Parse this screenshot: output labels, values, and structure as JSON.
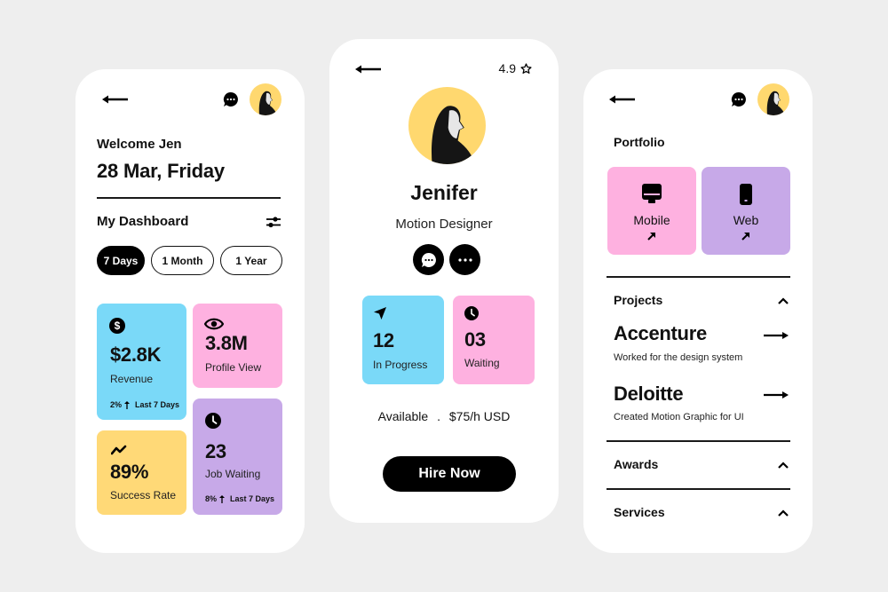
{
  "dashboard": {
    "welcome": "Welcome Jen",
    "date": "28 Mar, Friday",
    "section_title": "My Dashboard",
    "filters": [
      {
        "label": "7 Days",
        "active": true
      },
      {
        "label": "1 Month",
        "active": false
      },
      {
        "label": "1 Year",
        "active": false
      }
    ],
    "tiles": {
      "revenue": {
        "icon": "dollar-icon",
        "value": "$2.8K",
        "label": "Revenue",
        "footer_value": "2%",
        "footer_text": "Last 7 Days",
        "color": "#7ad9f8"
      },
      "profile_view": {
        "icon": "eye-icon",
        "value": "3.8M",
        "label": "Profile View",
        "color": "#feb1e0"
      },
      "success_rate": {
        "icon": "trend-icon",
        "value": "89%",
        "label": "Success Rate",
        "color": "#ffd977"
      },
      "job_waiting": {
        "icon": "clock-icon",
        "value": "23",
        "label": "Job Waiting",
        "footer_value": "8%",
        "footer_text": "Last 7 Days",
        "color": "#c7a9e8"
      }
    }
  },
  "profile": {
    "rating": "4.9",
    "name": "Jenifer",
    "role": "Motion Designer",
    "stats": {
      "in_progress": {
        "value": "12",
        "label": "In Progress",
        "color": "#7ad9f8"
      },
      "waiting": {
        "value": "03",
        "label": "Waiting",
        "color": "#feb1e0"
      }
    },
    "availability": "Available",
    "separator": ".",
    "rate": "$75/h USD",
    "hire_label": "Hire Now"
  },
  "portfolio": {
    "title": "Portfolio",
    "categories": [
      {
        "label": "Mobile",
        "color": "#feb1e0"
      },
      {
        "label": "Web",
        "color": "#c7a9e8"
      }
    ],
    "projects_title": "Projects",
    "projects": [
      {
        "name": "Accenture",
        "description": "Worked for the design system"
      },
      {
        "name": "Deloitte",
        "description": "Created Motion Graphic for UI"
      }
    ],
    "awards_title": "Awards",
    "services_title": "Services"
  },
  "colors": {
    "background": "#eeeeee",
    "avatar_bg": "#ffd86f",
    "accent_black": "#000000"
  }
}
